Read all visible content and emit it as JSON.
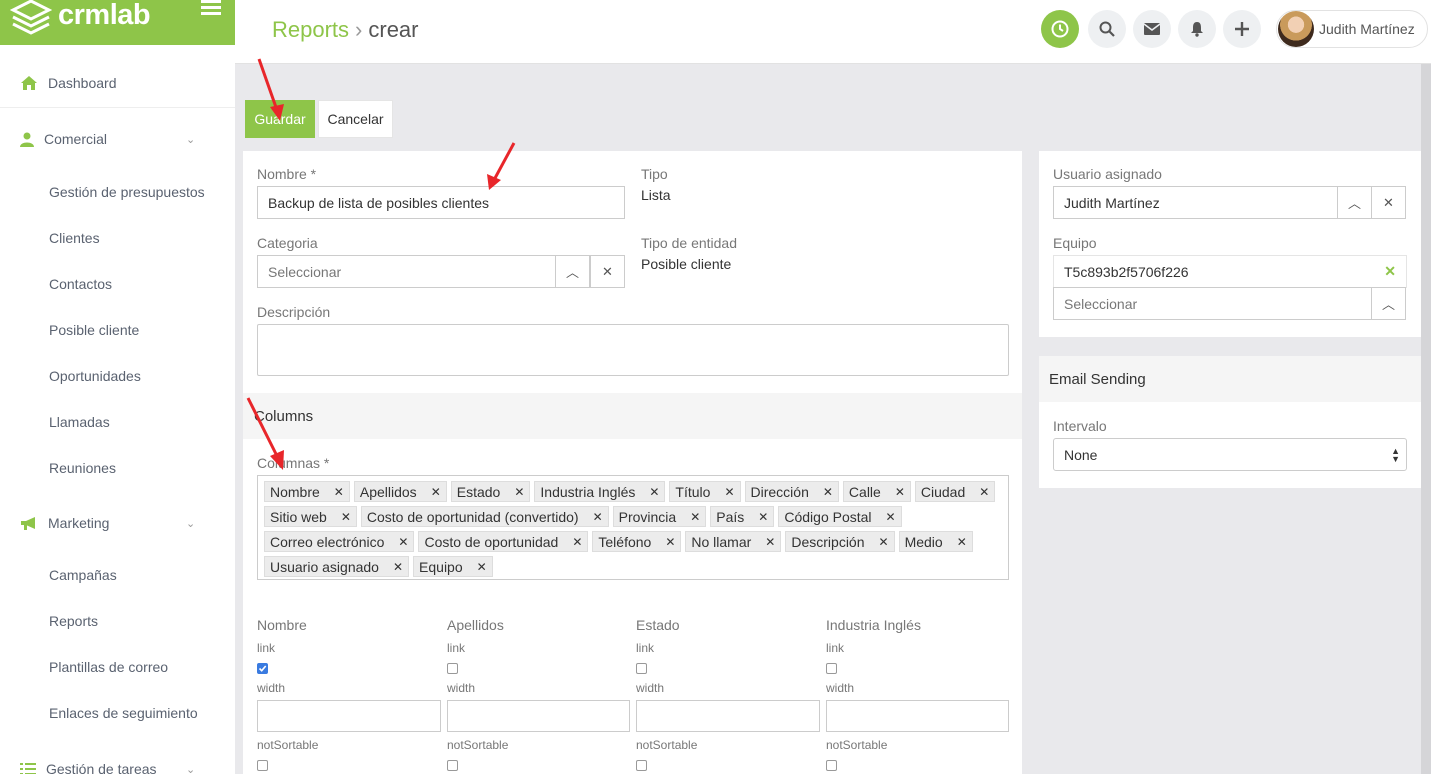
{
  "brand": {
    "name": "crmlab",
    "color": "#8ec549"
  },
  "sidebar": {
    "dashboard": "Dashboard",
    "comercial": "Comercial",
    "comercial_items": [
      "Gestión de presupuestos",
      "Clientes",
      "Contactos",
      "Posible cliente",
      "Oportunidades",
      "Llamadas",
      "Reuniones"
    ],
    "marketing": "Marketing",
    "marketing_items": [
      "Campañas",
      "Reports",
      "Plantillas de correo",
      "Enlaces de seguimiento"
    ],
    "tareas": "Gestión de tareas"
  },
  "header": {
    "breadcrumb_root": "Reports",
    "breadcrumb_sep": "›",
    "breadcrumb_current": "crear",
    "user_name": "Judith Martínez"
  },
  "actions": {
    "save": "Guardar",
    "cancel": "Cancelar"
  },
  "form": {
    "nombre_label": "Nombre *",
    "nombre_value": "Backup de lista de posibles clientes",
    "tipo_label": "Tipo",
    "tipo_value": "Lista",
    "categoria_label": "Categoria",
    "categoria_placeholder": "Seleccionar",
    "tipo_entidad_label": "Tipo de entidad",
    "tipo_entidad_value": "Posible cliente",
    "descripcion_label": "Descripción",
    "columns_section": "Columns",
    "columnas_label": "Columnas *",
    "columnas": [
      "Nombre",
      "Apellidos",
      "Estado",
      "Industria Inglés",
      "Título",
      "Dirección",
      "Calle",
      "Ciudad",
      "Sitio web",
      "Costo de oportunidad (convertido)",
      "Provincia",
      "País",
      "Código Postal",
      "Correo electrónico",
      "Costo de oportunidad",
      "Teléfono",
      "No llamar",
      "Descripción",
      "Medio",
      "Usuario asignado",
      "Equipo"
    ],
    "col_settings": [
      {
        "name": "Nombre",
        "link_label": "link",
        "link_checked": true,
        "width_label": "width",
        "not_sortable_label": "notSortable"
      },
      {
        "name": "Apellidos",
        "link_label": "link",
        "link_checked": false,
        "width_label": "width",
        "not_sortable_label": "notSortable"
      },
      {
        "name": "Estado",
        "link_label": "link",
        "link_checked": false,
        "width_label": "width",
        "not_sortable_label": "notSortable"
      },
      {
        "name": "Industria Inglés",
        "link_label": "link",
        "link_checked": false,
        "width_label": "width",
        "not_sortable_label": "notSortable"
      }
    ]
  },
  "side": {
    "usuario_label": "Usuario asignado",
    "usuario_value": "Judith Martínez",
    "equipo_label": "Equipo",
    "equipo_value": "T5c893b2f5706f226",
    "equipo_placeholder": "Seleccionar",
    "email_section": "Email Sending",
    "intervalo_label": "Intervalo",
    "intervalo_value": "None"
  }
}
